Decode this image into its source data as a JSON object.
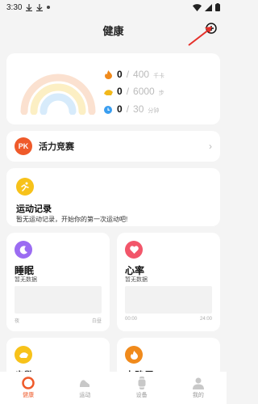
{
  "status_bar": {
    "time": "3:30"
  },
  "header": {
    "title": "健康",
    "add_icon": "plus-circle-icon"
  },
  "summary": {
    "metrics": [
      {
        "icon": "flame-icon",
        "color": "#f08a1c",
        "value": "0",
        "slash": "/",
        "goal": "400",
        "unit": "千卡"
      },
      {
        "icon": "steps-icon",
        "color": "#f2b81b",
        "value": "0",
        "slash": "/",
        "goal": "6000",
        "unit": "步"
      },
      {
        "icon": "clock-icon",
        "color": "#3a9ef0",
        "value": "0",
        "slash": "/",
        "goal": "30",
        "unit": "分钟"
      }
    ]
  },
  "pk": {
    "badge": "PK",
    "label": "活力竞赛"
  },
  "sport": {
    "title": "运动记录",
    "subtitle": "暂无运动记录，开始你的第一次运动吧!"
  },
  "sleep": {
    "title": "睡眠",
    "subtitle": "暂无数据",
    "axis_start": "夜",
    "axis_end": "白昼"
  },
  "heart": {
    "title": "心率",
    "subtitle": "暂无数据",
    "axis_start": "00:00",
    "axis_end": "24:00"
  },
  "steps": {
    "title": "步数"
  },
  "calories": {
    "title": "卡路里"
  },
  "nav": {
    "items": [
      {
        "label": "健康",
        "icon": "health-ring-icon",
        "active": true
      },
      {
        "label": "运动",
        "icon": "shoe-icon",
        "active": false
      },
      {
        "label": "设备",
        "icon": "watch-icon",
        "active": false
      },
      {
        "label": "我的",
        "icon": "person-icon",
        "active": false
      }
    ]
  },
  "colors": {
    "accent": "#ef5a2a",
    "sleep": "#9b6cf2",
    "heart": "#f2566a",
    "sport": "#f7c21a",
    "steps": "#f7c21a",
    "calories": "#f08a1c"
  }
}
